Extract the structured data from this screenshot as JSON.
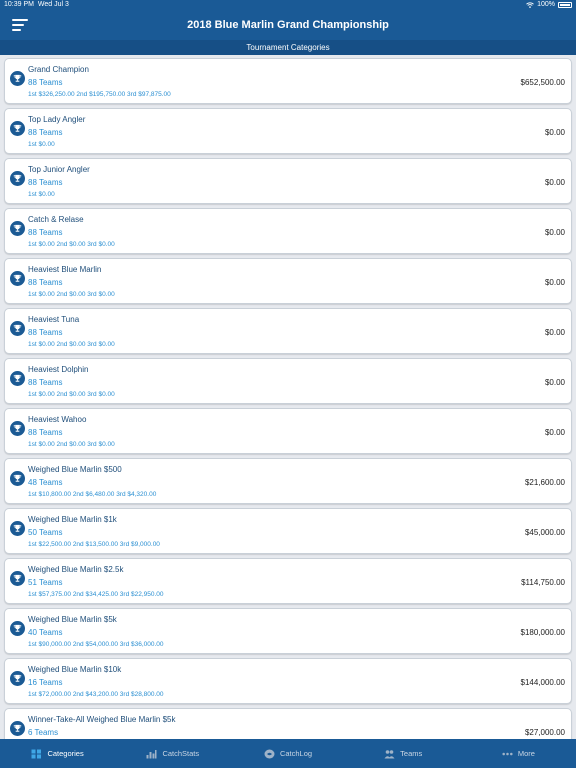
{
  "status": {
    "time": "10:39 PM",
    "date": "Wed Jul 3",
    "battery": "100%"
  },
  "header": {
    "title": "2018 Blue Marlin Grand Championship"
  },
  "subheader": {
    "title": "Tournament Categories"
  },
  "categories": [
    {
      "name": "Grand Champion",
      "teams": "88 Teams",
      "payouts": "1st $326,250.00 2nd $195,750.00 3rd $97,875.00",
      "amount": "$652,500.00"
    },
    {
      "name": "Top Lady Angler",
      "teams": "88 Teams",
      "payouts": "1st $0.00",
      "amount": "$0.00"
    },
    {
      "name": "Top Junior Angler",
      "teams": "88 Teams",
      "payouts": "1st $0.00",
      "amount": "$0.00"
    },
    {
      "name": "Catch & Relase",
      "teams": "88 Teams",
      "payouts": "1st $0.00 2nd $0.00 3rd $0.00",
      "amount": "$0.00"
    },
    {
      "name": "Heaviest Blue Marlin",
      "teams": "88 Teams",
      "payouts": "1st $0.00 2nd $0.00 3rd $0.00",
      "amount": "$0.00"
    },
    {
      "name": "Heaviest Tuna",
      "teams": "88 Teams",
      "payouts": "1st $0.00 2nd $0.00 3rd $0.00",
      "amount": "$0.00"
    },
    {
      "name": "Heaviest Dolphin",
      "teams": "88 Teams",
      "payouts": "1st $0.00 2nd $0.00 3rd $0.00",
      "amount": "$0.00"
    },
    {
      "name": "Heaviest Wahoo",
      "teams": "88 Teams",
      "payouts": "1st $0.00 2nd $0.00 3rd $0.00",
      "amount": "$0.00"
    },
    {
      "name": "Weighed Blue Marlin $500",
      "teams": "48 Teams",
      "payouts": "1st $10,800.00 2nd $6,480.00 3rd $4,320.00",
      "amount": "$21,600.00"
    },
    {
      "name": "Weighed Blue Marlin $1k",
      "teams": "50 Teams",
      "payouts": "1st $22,500.00 2nd $13,500.00 3rd $9,000.00",
      "amount": "$45,000.00"
    },
    {
      "name": "Weighed Blue Marlin $2.5k",
      "teams": "51 Teams",
      "payouts": "1st $57,375.00 2nd $34,425.00 3rd $22,950.00",
      "amount": "$114,750.00"
    },
    {
      "name": "Weighed Blue Marlin $5k",
      "teams": "40 Teams",
      "payouts": "1st $90,000.00 2nd $54,000.00 3rd $36,000.00",
      "amount": "$180,000.00"
    },
    {
      "name": "Weighed Blue Marlin $10k",
      "teams": "16 Teams",
      "payouts": "1st $72,000.00 2nd $43,200.00 3rd $28,800.00",
      "amount": "$144,000.00"
    },
    {
      "name": "Winner-Take-All Weighed Blue Marlin $5k",
      "teams": "6 Teams",
      "payouts": "",
      "amount": "$27,000.00"
    }
  ],
  "tabs": [
    {
      "label": "Categories",
      "icon": "grid-icon"
    },
    {
      "label": "CatchStats",
      "icon": "bar-chart-icon"
    },
    {
      "label": "CatchLog",
      "icon": "fish-icon"
    },
    {
      "label": "Teams",
      "icon": "people-icon"
    },
    {
      "label": "More",
      "icon": "more-dots-icon"
    }
  ],
  "colors": {
    "primary": "#1a5a96",
    "accent": "#2a8fd2",
    "background": "#e6e9ee"
  }
}
